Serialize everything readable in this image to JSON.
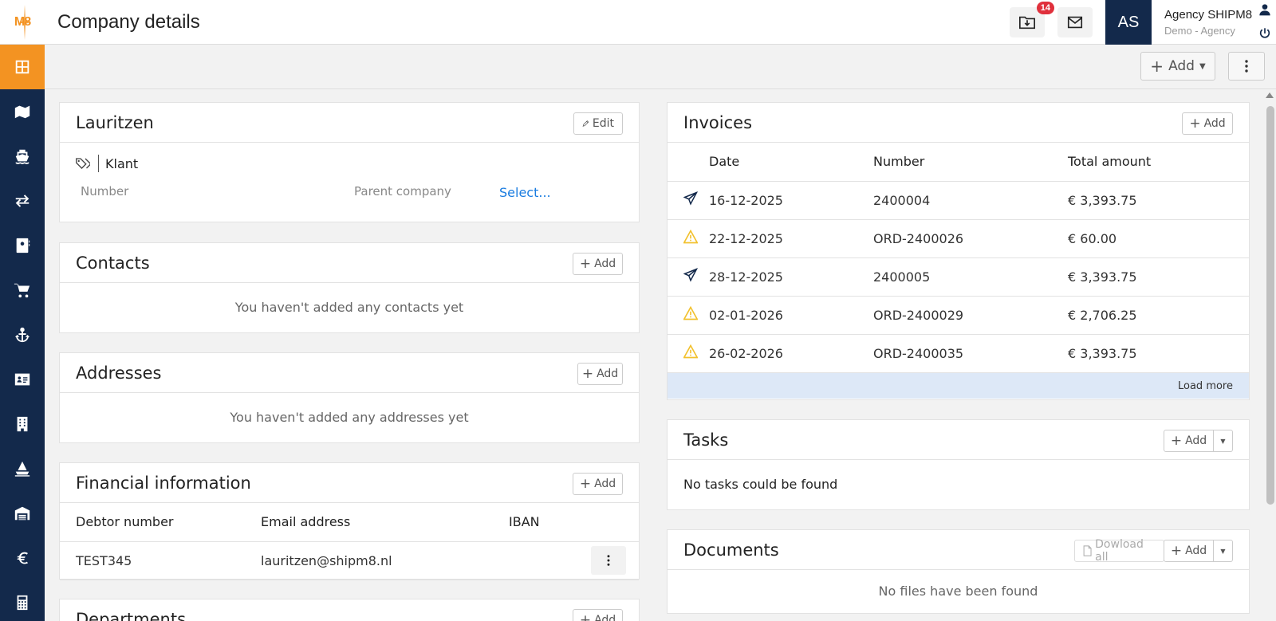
{
  "app": {
    "logo_text": "M8"
  },
  "header": {
    "title": "Company details",
    "notification_count": "14",
    "avatar_initials": "AS",
    "user_name": "Agency SHIPM8",
    "user_org": "Demo - Agency"
  },
  "toolbar": {
    "add_label": "Add"
  },
  "sidebar": {
    "items": [
      "dashboard-icon",
      "map-icon",
      "ship-icon",
      "transfer-icon",
      "contact-book-icon",
      "cart-icon",
      "anchor-icon",
      "id-card-icon",
      "building-icon",
      "boat-icon",
      "warehouse-icon",
      "euro-icon",
      "calculator-icon"
    ]
  },
  "company": {
    "name": "Lauritzen",
    "edit_label": "Edit",
    "tag": "Klant",
    "number_label": "Number",
    "parent_label": "Parent company",
    "parent_value": "Select..."
  },
  "contacts": {
    "title": "Contacts",
    "add_label": "Add",
    "empty": "You haven't added any contacts yet"
  },
  "addresses": {
    "title": "Addresses",
    "add_label": "Add",
    "empty": "You haven't added any addresses yet"
  },
  "financial": {
    "title": "Financial information",
    "add_label": "Add",
    "columns": [
      "Debtor number",
      "Email address",
      "IBAN"
    ],
    "rows": [
      {
        "debtor": "TEST345",
        "email": "lauritzen@shipm8.nl",
        "iban": ""
      }
    ]
  },
  "departments": {
    "title": "Departments",
    "add_label": "Add"
  },
  "invoices": {
    "title": "Invoices",
    "add_label": "Add",
    "columns": [
      "Date",
      "Number",
      "Total amount"
    ],
    "rows": [
      {
        "status": "sent",
        "date": "16-12-2025",
        "number": "2400004",
        "amount": "€ 3,393.75"
      },
      {
        "status": "warning",
        "date": "22-12-2025",
        "number": "ORD-2400026",
        "amount": "€ 60.00"
      },
      {
        "status": "sent",
        "date": "28-12-2025",
        "number": "2400005",
        "amount": "€ 3,393.75"
      },
      {
        "status": "warning",
        "date": "02-01-2026",
        "number": "ORD-2400029",
        "amount": "€ 2,706.25"
      },
      {
        "status": "warning",
        "date": "26-02-2026",
        "number": "ORD-2400035",
        "amount": "€ 3,393.75"
      }
    ],
    "load_more": "Load more"
  },
  "tasks": {
    "title": "Tasks",
    "add_label": "Add",
    "empty": "No tasks could be found"
  },
  "documents": {
    "title": "Documents",
    "download_all": "Dowload all",
    "add_label": "Add",
    "empty": "No files have been found"
  },
  "colors": {
    "sidebar": "#13294b",
    "accent": "#f39322",
    "link": "#1a7ce0",
    "badge": "#e0303c",
    "warning": "#f2c12e",
    "load_more_bg": "#dde8f7"
  }
}
